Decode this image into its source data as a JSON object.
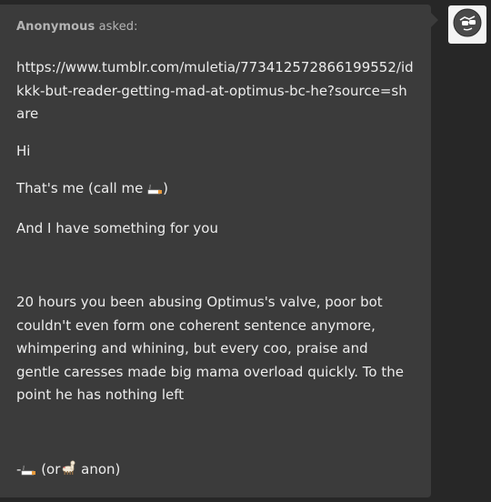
{
  "ask": {
    "asker": "Anonymous",
    "asked_label": "asked:",
    "url": "https://www.tumblr.com/muletia/773412572866199552/idkkk-but-reader-getting-mad-at-optimus-bc-he?source=share",
    "greeting": "Hi",
    "intro_prefix": "That's me (call me ",
    "intro_emoji": "cigarette",
    "intro_suffix": ")",
    "line_have": "And I have something for you",
    "story": "20 hours you been abusing Optimus's valve, poor bot couldn't even form one coherent sentence anymore, whimpering and whining, but every coo, praise and gentle caresses made big mama overload quickly. To the point he has nothing left",
    "sign_prefix": "-",
    "sign_middle": " (or",
    "sign_suffix": " anon)",
    "sign_emoji_1": "cigarette",
    "sign_emoji_2": "llama"
  },
  "avatar": {
    "icon": "sunglasses-face-icon"
  }
}
